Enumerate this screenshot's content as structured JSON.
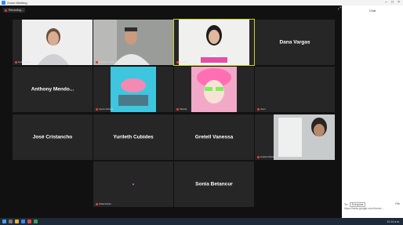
{
  "window": {
    "title": "Zoom Meeting"
  },
  "recording": {
    "label": "Recording..."
  },
  "tiles": {
    "t1": {
      "caption": "Helena Ruiz"
    },
    "t2": {
      "caption": "Camilo Lozada"
    },
    "t3": {
      "caption": "Daniela"
    },
    "t4": {
      "name": "Dana Vargas"
    },
    "t5": {
      "name": "Anthony  Mendo..."
    },
    "t6": {
      "caption": "Laura Vanesa"
    },
    "t7": {
      "caption": "Valeria"
    },
    "t8": {
      "caption": "Juan"
    },
    "t9": {
      "name": "José Cristancho"
    },
    "t10": {
      "name": "Yurileth Cubides"
    },
    "t11": {
      "name": "Gretell Vanessa"
    },
    "t12": {
      "caption": "Andrés Rubio"
    },
    "t13": {
      "caption": "Sofia Duran"
    },
    "t14": {
      "name": "Sonia Betancur"
    }
  },
  "sidebar": {
    "chat_title": "Chat",
    "to_label": "To:",
    "to_value": "Everyone",
    "file_label": "File",
    "input_text": "https://www.google.com/forms/..."
  },
  "taskbar": {
    "clock": "10:14 a.m."
  },
  "colors": {
    "active_speaker": "#c7d22b",
    "mic_muted": "#e53935",
    "tile_bg": "#262626"
  }
}
